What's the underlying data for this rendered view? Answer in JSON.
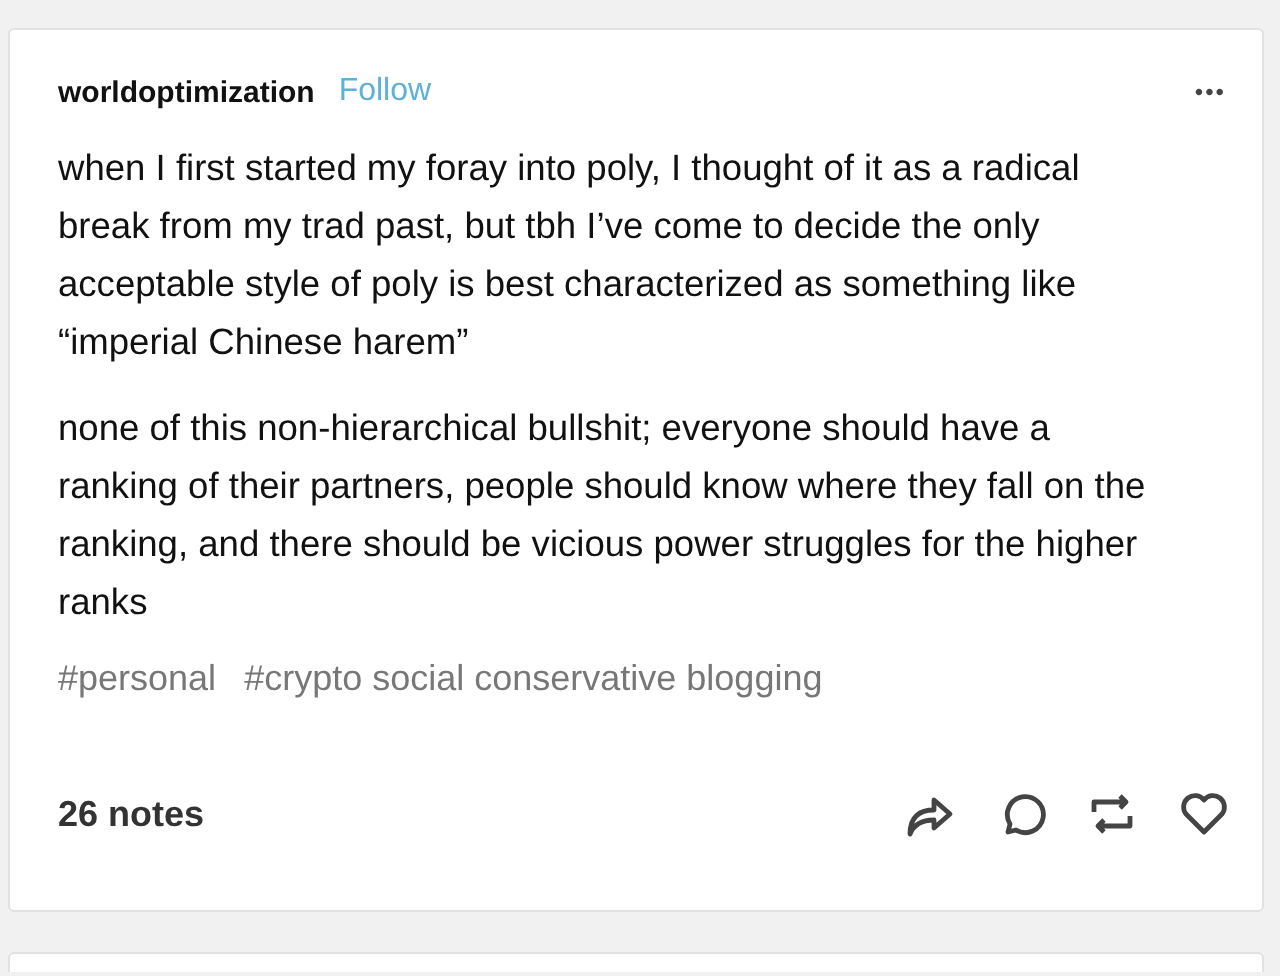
{
  "post": {
    "username": "worldoptimization",
    "follow": "Follow",
    "menu": "•••",
    "paragraphs": [
      "when I first started my foray into poly, I thought of it as a radical break from my trad past, but tbh I’ve come to decide the only acceptable style of poly is best characterized as something like “imperial Chinese harem”",
      "none of this non-hierarchical bullshit; everyone should have a ranking of their partners, people should know where they fall on the ranking, and there should be vicious power struggles for the higher ranks"
    ],
    "tags": [
      "#personal",
      "#crypto social conservative blogging"
    ],
    "notes": "26 notes"
  }
}
